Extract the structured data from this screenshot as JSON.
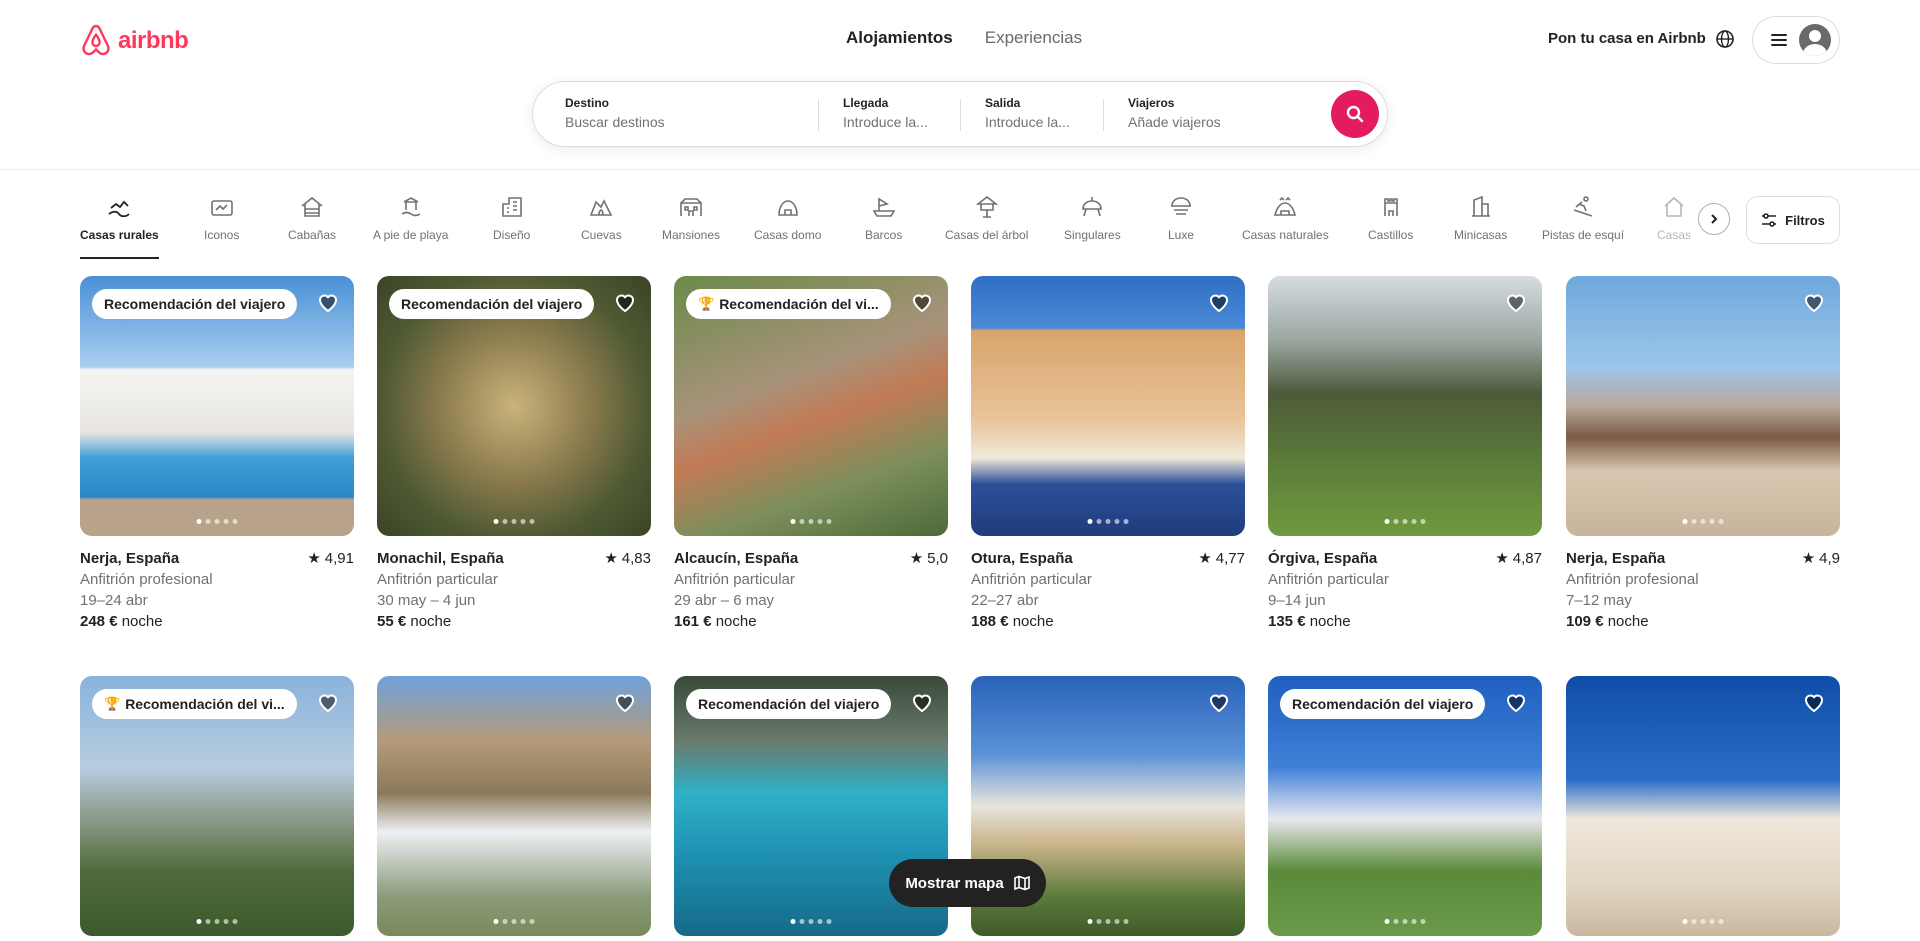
{
  "brand": {
    "name": "airbnb",
    "color": "#ff385c"
  },
  "nav": {
    "tabs": [
      {
        "label": "Alojamientos"
      },
      {
        "label": "Experiencias"
      }
    ]
  },
  "header": {
    "host_link": "Pon tu casa en Airbnb",
    "globe_icon": "globe-icon",
    "menu_icon": "hamburger-icon",
    "avatar_icon": "user-icon"
  },
  "search": {
    "destination": {
      "label": "Destino",
      "placeholder": "Buscar destinos"
    },
    "checkin": {
      "label": "Llegada",
      "placeholder": "Introduce la..."
    },
    "checkout": {
      "label": "Salida",
      "placeholder": "Introduce la..."
    },
    "guests": {
      "label": "Viajeros",
      "placeholder": "Añade viajeros"
    },
    "button_icon": "search-icon",
    "button_color": "#e31c5f"
  },
  "categories": [
    {
      "label": "Casas rurales",
      "icon": "countryside-icon"
    },
    {
      "label": "Iconos",
      "icon": "icons-icon"
    },
    {
      "label": "Cabañas",
      "icon": "cabin-icon"
    },
    {
      "label": "A pie de playa",
      "icon": "beachfront-icon"
    },
    {
      "label": "Diseño",
      "icon": "design-icon"
    },
    {
      "label": "Cuevas",
      "icon": "cave-icon"
    },
    {
      "label": "Mansiones",
      "icon": "mansion-icon"
    },
    {
      "label": "Casas domo",
      "icon": "dome-icon"
    },
    {
      "label": "Barcos",
      "icon": "boat-icon"
    },
    {
      "label": "Casas del árbol",
      "icon": "treehouse-icon"
    },
    {
      "label": "Singulares",
      "icon": "omg-icon"
    },
    {
      "label": "Luxe",
      "icon": "luxe-icon"
    },
    {
      "label": "Casas naturales",
      "icon": "earth-home-icon"
    },
    {
      "label": "Castillos",
      "icon": "castle-icon"
    },
    {
      "label": "Minicasas",
      "icon": "tiny-home-icon"
    },
    {
      "label": "Pistas de esquí",
      "icon": "ski-icon"
    },
    {
      "label": "Casas",
      "icon": "house-icon"
    }
  ],
  "filters": {
    "label": "Filtros",
    "icon": "sliders-icon"
  },
  "listings": [
    {
      "badge": "Recomendación del viajero",
      "trophy": false,
      "location": "Nerja, España",
      "rating": "4,91",
      "host": "Anfitrión profesional",
      "dates": "19–24 abr",
      "price": "248 €",
      "price_unit": "noche"
    },
    {
      "badge": "Recomendación del viajero",
      "trophy": false,
      "location": "Monachil, España",
      "rating": "4,83",
      "host": "Anfitrión particular",
      "dates": "30 may – 4 jun",
      "price": "55 €",
      "price_unit": "noche"
    },
    {
      "badge": "Recomendación del vi...",
      "trophy": true,
      "location": "Alcaucín, España",
      "rating": "5,0",
      "host": "Anfitrión particular",
      "dates": "29 abr – 6 may",
      "price": "161 €",
      "price_unit": "noche"
    },
    {
      "badge": "",
      "trophy": false,
      "location": "Otura, España",
      "rating": "4,77",
      "host": "Anfitrión particular",
      "dates": "22–27 abr",
      "price": "188 €",
      "price_unit": "noche"
    },
    {
      "badge": "",
      "trophy": false,
      "location": "Órgiva, España",
      "rating": "4,87",
      "host": "Anfitrión particular",
      "dates": "9–14 jun",
      "price": "135 €",
      "price_unit": "noche"
    },
    {
      "badge": "",
      "trophy": false,
      "location": "Nerja, España",
      "rating": "4,9",
      "host": "Anfitrión profesional",
      "dates": "7–12 may",
      "price": "109 €",
      "price_unit": "noche"
    },
    {
      "badge": "Recomendación del vi...",
      "trophy": true
    },
    {
      "badge": "",
      "trophy": false
    },
    {
      "badge": "Recomendación del viajero",
      "trophy": false
    },
    {
      "badge": "",
      "trophy": false
    },
    {
      "badge": "Recomendación del viajero",
      "trophy": false
    },
    {
      "badge": "",
      "trophy": false
    }
  ],
  "map_button": {
    "label": "Mostrar mapa",
    "icon": "map-icon"
  }
}
